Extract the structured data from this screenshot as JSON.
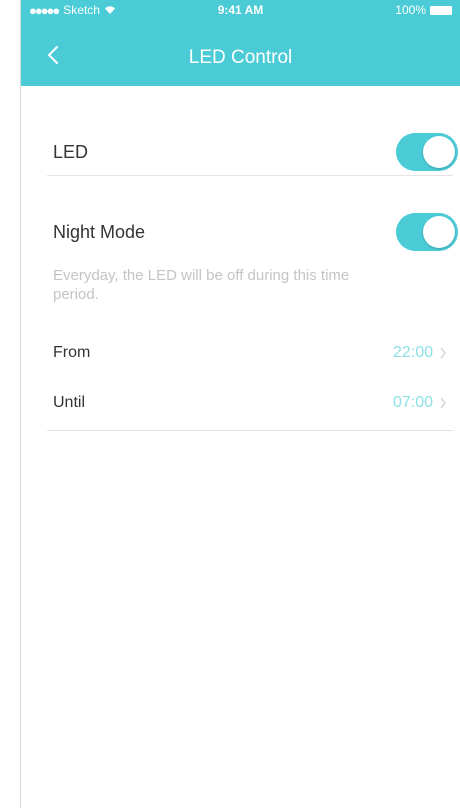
{
  "status_bar": {
    "carrier": "Sketch",
    "time": "9:41 AM",
    "battery": "100%"
  },
  "nav": {
    "title": "LED Control",
    "back_icon": "chevron-left-icon"
  },
  "led": {
    "label": "LED",
    "enabled": true
  },
  "night_mode": {
    "label": "Night Mode",
    "enabled": true,
    "description": "Everyday, the LED will be off during this time period.",
    "from": {
      "label": "From",
      "value": "22:00"
    },
    "until": {
      "label": "Until",
      "value": "07:00"
    }
  },
  "colors": {
    "accent": "#4ACBD6",
    "time_value": "#8de0e6",
    "description_text": "#c4c4c4"
  }
}
